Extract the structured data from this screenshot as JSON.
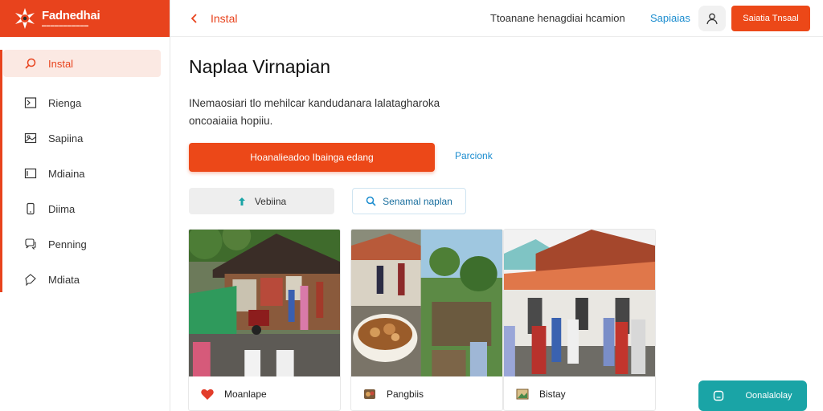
{
  "brand": {
    "name": "Fadnedhai"
  },
  "sidebar": {
    "items": [
      {
        "label": "Instal",
        "icon": "search-icon",
        "active": true
      },
      {
        "label": "Rienga",
        "icon": "terminal-icon"
      },
      {
        "label": "Sapiina",
        "icon": "image-icon"
      },
      {
        "label": "Mdiaina",
        "icon": "window-icon"
      },
      {
        "label": "Diima",
        "icon": "phone-icon"
      },
      {
        "label": "Penning",
        "icon": "chat-icon"
      },
      {
        "label": "Mdiata",
        "icon": "chat-bubble-icon"
      }
    ]
  },
  "topbar": {
    "back_label": "Instal",
    "center_text": "Ttoanane henagdiai hcamion",
    "link_label": "Sapiaias",
    "cta_label": "Saiatia Tnsaal"
  },
  "main": {
    "title": "Naplaa Virnapian",
    "description": "INemaosiari tlo mehilcar kandudanara lalatagharoka oncoaiaiia hopiiu.",
    "primary_button": "Hoanalieadoo Ibainga edang",
    "secondary_link": "Parcionk",
    "gray_button": "Vebiina",
    "search_button": "Senamal naplan"
  },
  "cards": [
    {
      "label": "Moanlape",
      "icon": "heart-icon"
    },
    {
      "label": "Pangbiis",
      "icon": "food-icon"
    },
    {
      "label": "Bistay",
      "icon": "picture-icon"
    }
  ],
  "floating": {
    "label": "Oonalalolay"
  },
  "colors": {
    "accent": "#e8431d",
    "link": "#1a8ccf",
    "teal": "#1aa4a6"
  }
}
